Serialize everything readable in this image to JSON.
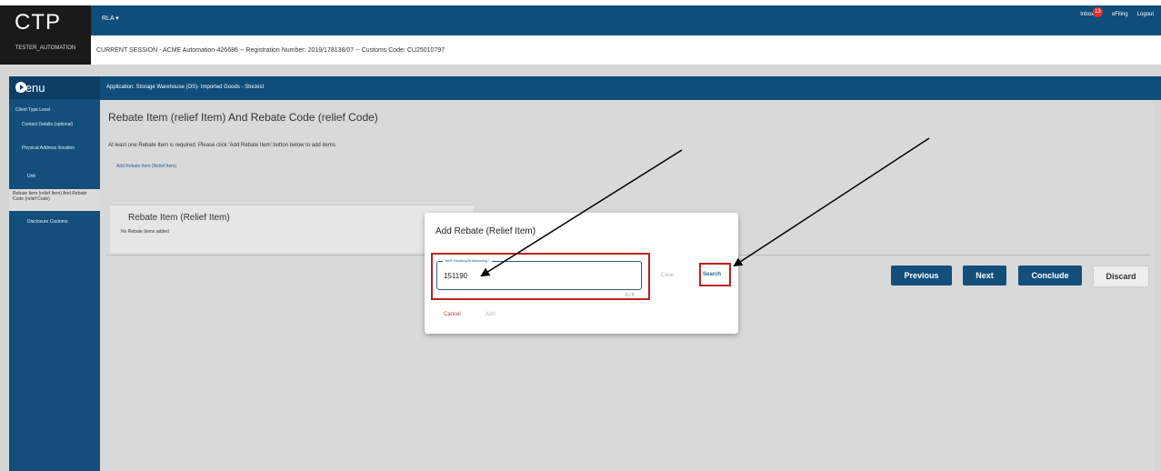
{
  "brand": "CTP",
  "user": "TESTER_AUTOMATION",
  "top_menu": "RLA ▾",
  "header_links": {
    "inbox": "Inbox",
    "inbox_count": "13",
    "efiling": "eFiling",
    "logout": "Logout"
  },
  "session_text": "CURRENT SESSION - ACME Automation-426686 -- Registration Number: 2019/178138/07 -- Customs Code: CU25010797",
  "menu": {
    "title": "Menu",
    "items": [
      "Client Type Level",
      "Contact Details (optional)",
      "Physical Address /location",
      "Unit",
      "Rebate Item (relief Item) And Rebate Code (relief Code)",
      "Disclosure Customs"
    ]
  },
  "application_bar": "Application: Storage Warehouse (OS)- Imported Goods - Stockist",
  "page": {
    "title": "Rebate Item (relief Item) And Rebate Code (relief Code)",
    "info": "At least one Rebate Item is required. Please click 'Add Rebate Item' button below to add items.",
    "add_link": "Add Rebate Item (Relief Item)",
    "card_title": "Rebate Item (Relief Item)",
    "card_empty": "No Rebate Items added"
  },
  "buttons": {
    "previous": "Previous",
    "next": "Next",
    "conclude": "Conclude",
    "discard": "Discard"
  },
  "modal": {
    "title": "Add Rebate (Relief Item)",
    "field_label": "Tariff Heading/Subheading *",
    "field_value": "151190",
    "counter": "6 / 6",
    "clear": "Clear",
    "search": "Search",
    "cancel": "Cancel",
    "add": "Add"
  },
  "colors": {
    "primary": "#0f4d7a",
    "highlight": "#c0201f",
    "danger": "#c0392b"
  }
}
